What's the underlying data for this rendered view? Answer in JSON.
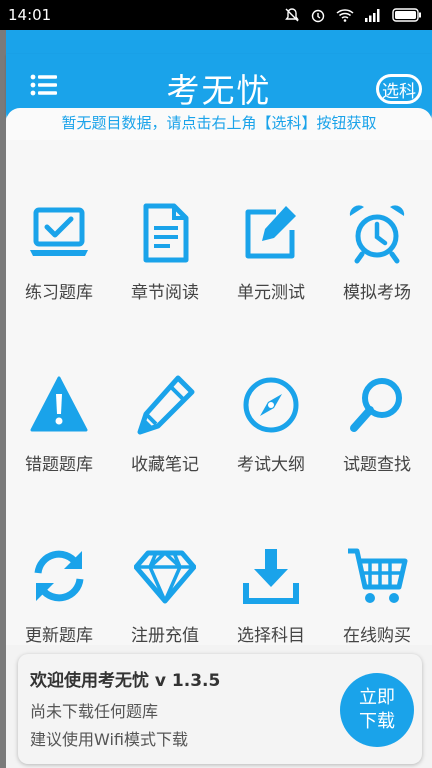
{
  "status_bar": {
    "time": "14:01"
  },
  "header": {
    "title": "考无忧",
    "select_label": "选科"
  },
  "notice": "暂无题目数据，请点击右上角【选科】按钮获取",
  "grid": [
    {
      "label": "练习题库",
      "icon": "laptop-check-icon"
    },
    {
      "label": "章节阅读",
      "icon": "document-icon"
    },
    {
      "label": "单元测试",
      "icon": "edit-icon"
    },
    {
      "label": "模拟考场",
      "icon": "alarm-clock-icon"
    },
    {
      "label": "错题题库",
      "icon": "warning-icon"
    },
    {
      "label": "收藏笔记",
      "icon": "pen-icon"
    },
    {
      "label": "考试大纲",
      "icon": "compass-icon"
    },
    {
      "label": "试题查找",
      "icon": "search-icon"
    },
    {
      "label": "更新题库",
      "icon": "refresh-icon"
    },
    {
      "label": "注册充值",
      "icon": "diamond-icon"
    },
    {
      "label": "选择科目",
      "icon": "download-icon"
    },
    {
      "label": "在线购买",
      "icon": "cart-icon"
    }
  ],
  "bottom": {
    "welcome": "欢迎使用考无忧 v 1.3.5",
    "line1": "尚未下载任何题库",
    "line2": "建议使用Wifi模式下载",
    "download_line1": "立即",
    "download_line2": "下载"
  },
  "colors": {
    "accent": "#1aa3ea",
    "text": "#444444"
  }
}
